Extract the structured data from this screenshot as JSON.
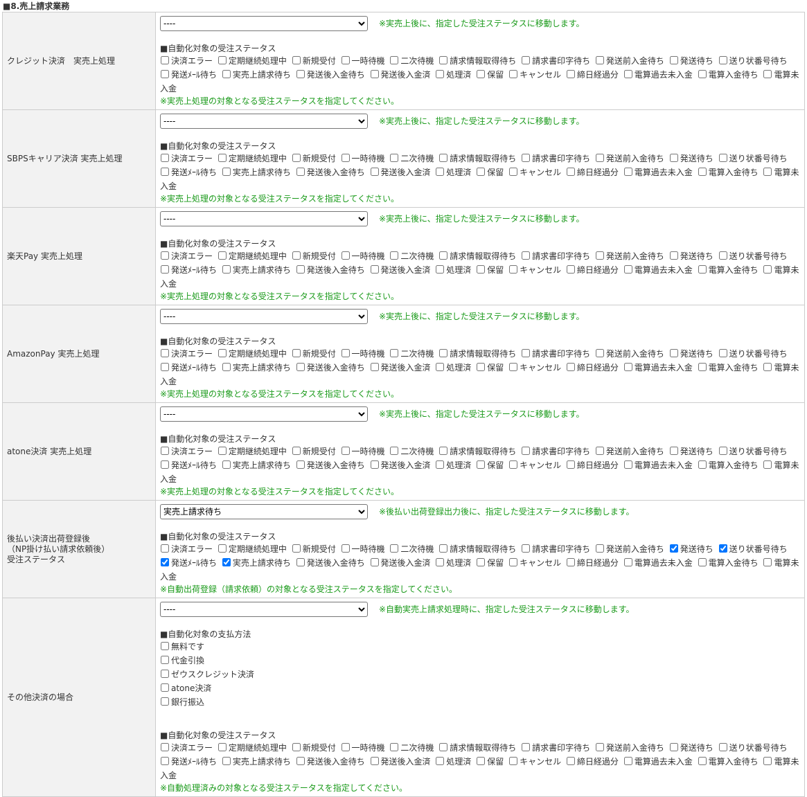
{
  "section_title": "■8.売上請求業務",
  "status_heading": "■自動化対象の受注ステータス",
  "payment_heading": "■自動化対象の支払方法",
  "statuses": [
    "決済エラー",
    "定期継続処理中",
    "新規受付",
    "一時待機",
    "二次待機",
    "請求情報取得待ち",
    "請求書印字待ち",
    "発送前入金待ち",
    "発送待ち",
    "送り状番号待ち",
    "発送ﾒｰﾙ待ち",
    "実売上請求待ち",
    "発送後入金待ち",
    "発送後入金済",
    "処理済",
    "保留",
    "キャンセル",
    "締日経過分",
    "電算過去未入金",
    "電算入金待ち",
    "電算未入金"
  ],
  "rows": [
    {
      "label": "クレジット決済　実売上処理",
      "select_value": "----",
      "move_note": "※実売上後に、指定した受注ステータスに移動します。",
      "target_note": "※実売上処理の対象となる受注ステータスを指定してください。",
      "checked": []
    },
    {
      "label": "SBPSキャリア決済 実売上処理",
      "select_value": "----",
      "move_note": "※実売上後に、指定した受注ステータスに移動します。",
      "target_note": "※実売上処理の対象となる受注ステータスを指定してください。",
      "checked": []
    },
    {
      "label": "楽天Pay 実売上処理",
      "select_value": "----",
      "move_note": "※実売上後に、指定した受注ステータスに移動します。",
      "target_note": "※実売上処理の対象となる受注ステータスを指定してください。",
      "checked": []
    },
    {
      "label": "AmazonPay 実売上処理",
      "select_value": "----",
      "move_note": "※実売上後に、指定した受注ステータスに移動します。",
      "target_note": "※実売上処理の対象となる受注ステータスを指定してください。",
      "checked": []
    },
    {
      "label": "atone決済 実売上処理",
      "select_value": "----",
      "move_note": "※実売上後に、指定した受注ステータスに移動します。",
      "target_note": "※実売上処理の対象となる受注ステータスを指定してください。",
      "checked": []
    },
    {
      "label": "後払い決済出荷登録後\n（NP掛け払い請求依頼後）\n受注ステータス",
      "select_value": "実売上請求待ち",
      "move_note": "※後払い出荷登録出力後に、指定した受注ステータスに移動します。",
      "target_note": "※自動出荷登録（請求依頼）の対象となる受注ステータスを指定してください。",
      "checked": [
        8,
        9,
        10,
        11
      ]
    },
    {
      "label": "その他決済の場合",
      "select_value": "----",
      "move_note": "※自動実売上請求処理時に、指定した受注ステータスに移動します。",
      "target_note": "※自動処理済みの対象となる受注ステータスを指定してください。",
      "checked": [],
      "payment_methods": [
        "無料です",
        "代金引換",
        "ゼウスクレジット決済",
        "atone決済",
        "銀行振込"
      ]
    }
  ],
  "colors": {
    "note": "#1a9a1a",
    "label_bg": "#f2f2f2",
    "border": "#cccccc"
  }
}
